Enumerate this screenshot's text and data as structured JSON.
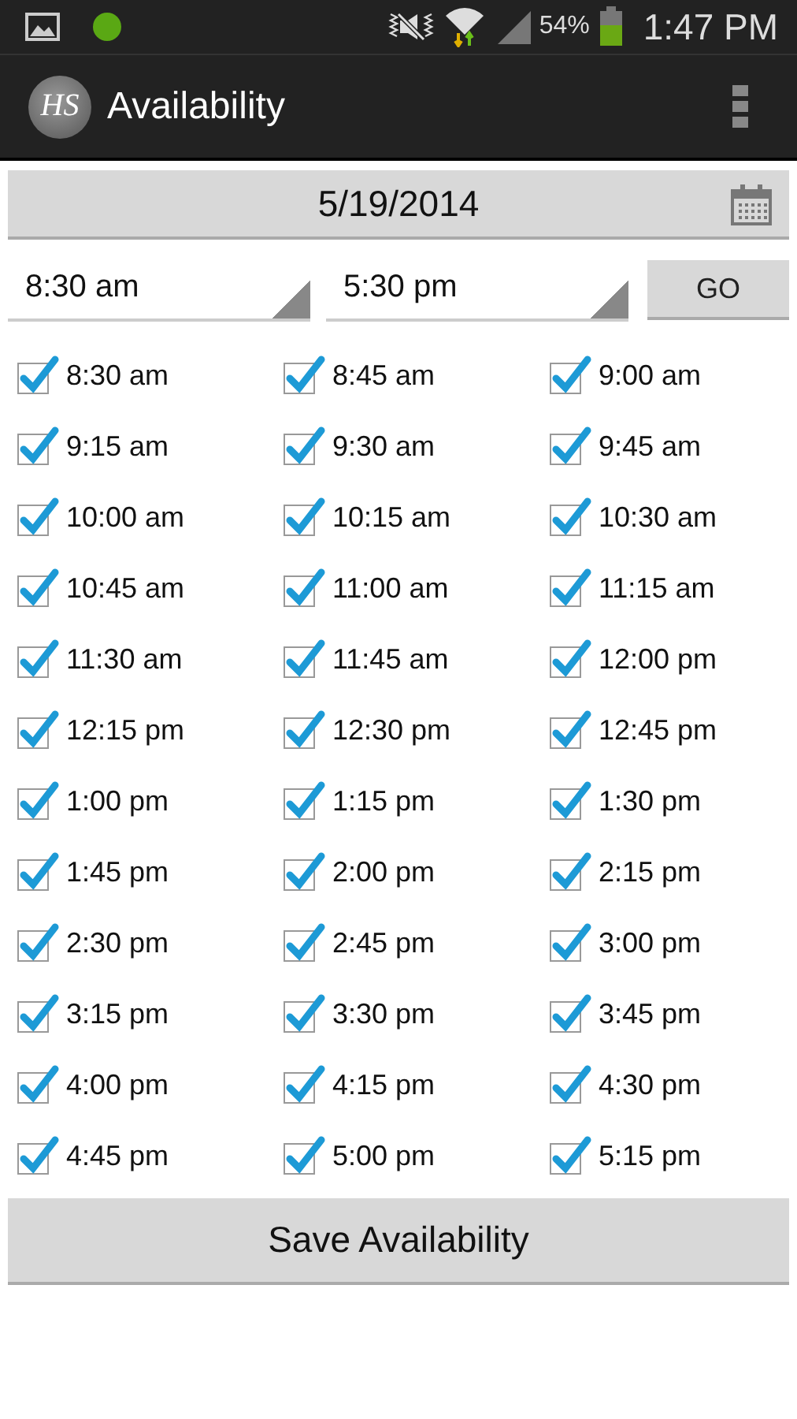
{
  "status_bar": {
    "battery": "54%",
    "time": "1:47 PM"
  },
  "action_bar": {
    "logo": "HS",
    "title": "Availability"
  },
  "date_button": {
    "label": "5/19/2014"
  },
  "start_spinner": {
    "value": "8:30 am"
  },
  "end_spinner": {
    "value": "5:30 pm"
  },
  "go_button": {
    "label": "GO"
  },
  "slots": [
    {
      "label": "8:30 am",
      "checked": true
    },
    {
      "label": "8:45 am",
      "checked": true
    },
    {
      "label": "9:00 am",
      "checked": true
    },
    {
      "label": "9:15 am",
      "checked": true
    },
    {
      "label": "9:30 am",
      "checked": true
    },
    {
      "label": "9:45 am",
      "checked": true
    },
    {
      "label": "10:00 am",
      "checked": true
    },
    {
      "label": "10:15 am",
      "checked": true
    },
    {
      "label": "10:30 am",
      "checked": true
    },
    {
      "label": "10:45 am",
      "checked": true
    },
    {
      "label": "11:00 am",
      "checked": true
    },
    {
      "label": "11:15 am",
      "checked": true
    },
    {
      "label": "11:30 am",
      "checked": true
    },
    {
      "label": "11:45 am",
      "checked": true
    },
    {
      "label": "12:00 pm",
      "checked": true
    },
    {
      "label": "12:15 pm",
      "checked": true
    },
    {
      "label": "12:30 pm",
      "checked": true
    },
    {
      "label": "12:45 pm",
      "checked": true
    },
    {
      "label": "1:00 pm",
      "checked": true
    },
    {
      "label": "1:15 pm",
      "checked": true
    },
    {
      "label": "1:30 pm",
      "checked": true
    },
    {
      "label": "1:45 pm",
      "checked": true
    },
    {
      "label": "2:00 pm",
      "checked": true
    },
    {
      "label": "2:15 pm",
      "checked": true
    },
    {
      "label": "2:30 pm",
      "checked": true
    },
    {
      "label": "2:45 pm",
      "checked": true
    },
    {
      "label": "3:00 pm",
      "checked": true
    },
    {
      "label": "3:15 pm",
      "checked": true
    },
    {
      "label": "3:30 pm",
      "checked": true
    },
    {
      "label": "3:45 pm",
      "checked": true
    },
    {
      "label": "4:00 pm",
      "checked": true
    },
    {
      "label": "4:15 pm",
      "checked": true
    },
    {
      "label": "4:30 pm",
      "checked": true
    },
    {
      "label": "4:45 pm",
      "checked": true
    },
    {
      "label": "5:00 pm",
      "checked": true
    },
    {
      "label": "5:15 pm",
      "checked": true
    }
  ],
  "save_button": {
    "label": "Save Availability"
  }
}
